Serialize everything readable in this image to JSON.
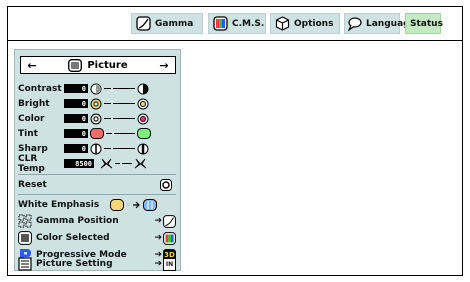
{
  "tabs": [
    {
      "label": "Gamma",
      "icon": "gamma-curve-icon"
    },
    {
      "label": "C.M.S.",
      "icon": "cms-color-icon"
    },
    {
      "label": "Options",
      "icon": "options-cube-icon"
    },
    {
      "label": "Language",
      "icon": "speech-bubble-icon"
    },
    {
      "label": "Status",
      "icon": ""
    }
  ],
  "menu": {
    "title": "Picture",
    "left_arrow": "←",
    "right_arrow": "→",
    "adjustments": [
      {
        "label": "Contrast",
        "value": "0"
      },
      {
        "label": "Bright",
        "value": "0"
      },
      {
        "label": "Color",
        "value": "0"
      },
      {
        "label": "Tint",
        "value": "0"
      },
      {
        "label": "Sharp",
        "value": "0"
      }
    ],
    "clr_temp": {
      "label": "CLR Temp",
      "value": "8500"
    },
    "reset": {
      "label": "Reset"
    },
    "white_emphasis": {
      "label": "White Emphasis"
    },
    "items": [
      {
        "label": "Gamma Position",
        "arrow": "➔"
      },
      {
        "label": "Color Selected",
        "arrow": "➔"
      },
      {
        "label": "Progressive Mode",
        "arrow": "➔",
        "badge": "3D"
      },
      {
        "label": "Picture Setting",
        "arrow": "➔",
        "badge": "IN"
      }
    ]
  },
  "colors": {
    "tab_bg": "#cfe3e4",
    "status_bg": "#c3eac3",
    "menu_bg": "#cfe2e2",
    "tint_red": "#ff6a6a",
    "tint_green": "#7ef07e",
    "bright_yellow": "#f0d870",
    "white_emphasis_blue": "#7fb8ff"
  }
}
